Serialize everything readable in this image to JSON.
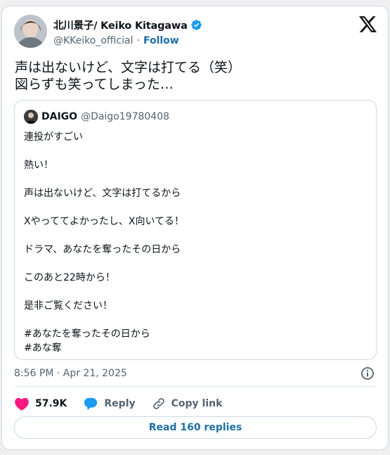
{
  "author": {
    "display_name": "北川景子/ Keiko Kitagawa",
    "handle": "@KKeiko_official",
    "separator": "·",
    "follow_label": "Follow",
    "verified": true
  },
  "tweet": {
    "lines": [
      "声は出ないけど、文字は打てる（笑）",
      "図らずも笑ってしまった…"
    ]
  },
  "quote": {
    "display_name": "DAIGO",
    "handle": "@Daigo19780408",
    "lines": [
      "連投がすごい",
      "",
      "熱い！",
      "",
      "声は出ないけど、文字は打てるから",
      "",
      "Xやっててよかったし、X向いてる！",
      "",
      "ドラマ、あなたを奪ったその日から",
      "",
      "このあと22時から！",
      "",
      "是非ご覧ください！",
      "",
      "#あなたを奪ったその日から",
      "#あな奪"
    ]
  },
  "timestamp": "8:56 PM · Apr 21, 2025",
  "actions": {
    "like_count": "57.9K",
    "reply_label": "Reply",
    "copy_link_label": "Copy link"
  },
  "read_replies_label": "Read 160 replies",
  "colors": {
    "accent": "#1d6fa5",
    "like": "#f91880",
    "verified": "#1d9bf0",
    "reply_icon": "#1d9bf0"
  }
}
